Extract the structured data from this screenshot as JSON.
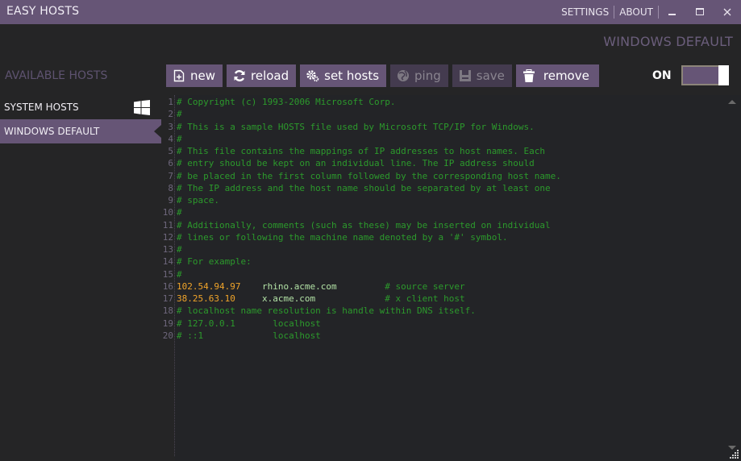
{
  "window": {
    "title": "EASY HOSTS",
    "links": [
      "SETTINGS",
      "ABOUT"
    ],
    "controls": [
      "minimize",
      "maximize",
      "close"
    ]
  },
  "header": {
    "profile_name": "WINDOWS DEFAULT"
  },
  "sidebar": {
    "heading": "AVAILABLE HOSTS",
    "items": [
      {
        "label": "SYSTEM HOSTS",
        "icon": "windows-logo-icon",
        "active": false
      },
      {
        "label": "WINDOWS DEFAULT",
        "active": true
      }
    ]
  },
  "toolbar": {
    "buttons": [
      {
        "label": "new",
        "icon": "new-file-icon",
        "enabled": true
      },
      {
        "label": "reload",
        "icon": "reload-icon",
        "enabled": true
      },
      {
        "label": "set hosts",
        "icon": "gears-icon",
        "enabled": true
      },
      {
        "label": "ping",
        "icon": "globe-icon",
        "enabled": false
      },
      {
        "label": "save",
        "icon": "floppy-disk-icon",
        "enabled": false
      },
      {
        "label": "remove",
        "icon": "trash-icon",
        "enabled": true
      }
    ]
  },
  "toggle": {
    "label": "ON",
    "state": true
  },
  "colors": {
    "accent": "#665576",
    "background": "#252526",
    "comment": "#2c9a2c",
    "ip": "#f0a42a",
    "host": "#b3e3a6"
  },
  "editor": {
    "lines": [
      {
        "n": "1",
        "text": "# Copyright (c) 1993-2006 Microsoft Corp."
      },
      {
        "n": "2",
        "text": "#"
      },
      {
        "n": "3",
        "text": "# This is a sample HOSTS file used by Microsoft TCP/IP for Windows."
      },
      {
        "n": "4",
        "text": "#"
      },
      {
        "n": "5",
        "text": "# This file contains the mappings of IP addresses to host names. Each"
      },
      {
        "n": "6",
        "text": "# entry should be kept on an individual line. The IP address should"
      },
      {
        "n": "7",
        "text": "# be placed in the first column followed by the corresponding host name."
      },
      {
        "n": "8",
        "text": "# The IP address and the host name should be separated by at least one"
      },
      {
        "n": "9",
        "text": "# space."
      },
      {
        "n": "10",
        "text": "#"
      },
      {
        "n": "11",
        "text": "# Additionally, comments (such as these) may be inserted on individual"
      },
      {
        "n": "12",
        "text": "# lines or following the machine name denoted by a '#' symbol."
      },
      {
        "n": "13",
        "text": "#"
      },
      {
        "n": "14",
        "text": "# For example:"
      },
      {
        "n": "15",
        "text": "#"
      },
      {
        "n": "16",
        "ip": "102.54.94.97",
        "host": "rhino.acme.com",
        "comment": "# source server"
      },
      {
        "n": "17",
        "ip": "38.25.63.10",
        "host": "x.acme.com",
        "comment": "# x client host"
      },
      {
        "n": "18",
        "text": "# localhost name resolution is handle within DNS itself."
      },
      {
        "n": "19",
        "text": "# 127.0.0.1       localhost"
      },
      {
        "n": "20",
        "text": "# ::1             localhost"
      }
    ]
  }
}
